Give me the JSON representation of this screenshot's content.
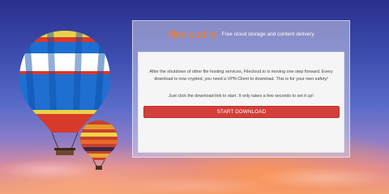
{
  "header": {
    "logo_text": "filecloud.io",
    "tagline": "Free cloud storage and content delivery"
  },
  "content": {
    "message": "After the shutdown of other file hosting services, Filecloud.io is moving one step forward. Every download is now crypted, you need a VPN Client to download. This is for your own safety!",
    "instruction": "Just click the download-link to start. It only takes a few seconds to set it up!",
    "download_button_label": "START DOWNLOAD"
  },
  "colors": {
    "logo": "#ff7a1a",
    "button": "#d33f3a",
    "panel": "#f5f5f6"
  }
}
